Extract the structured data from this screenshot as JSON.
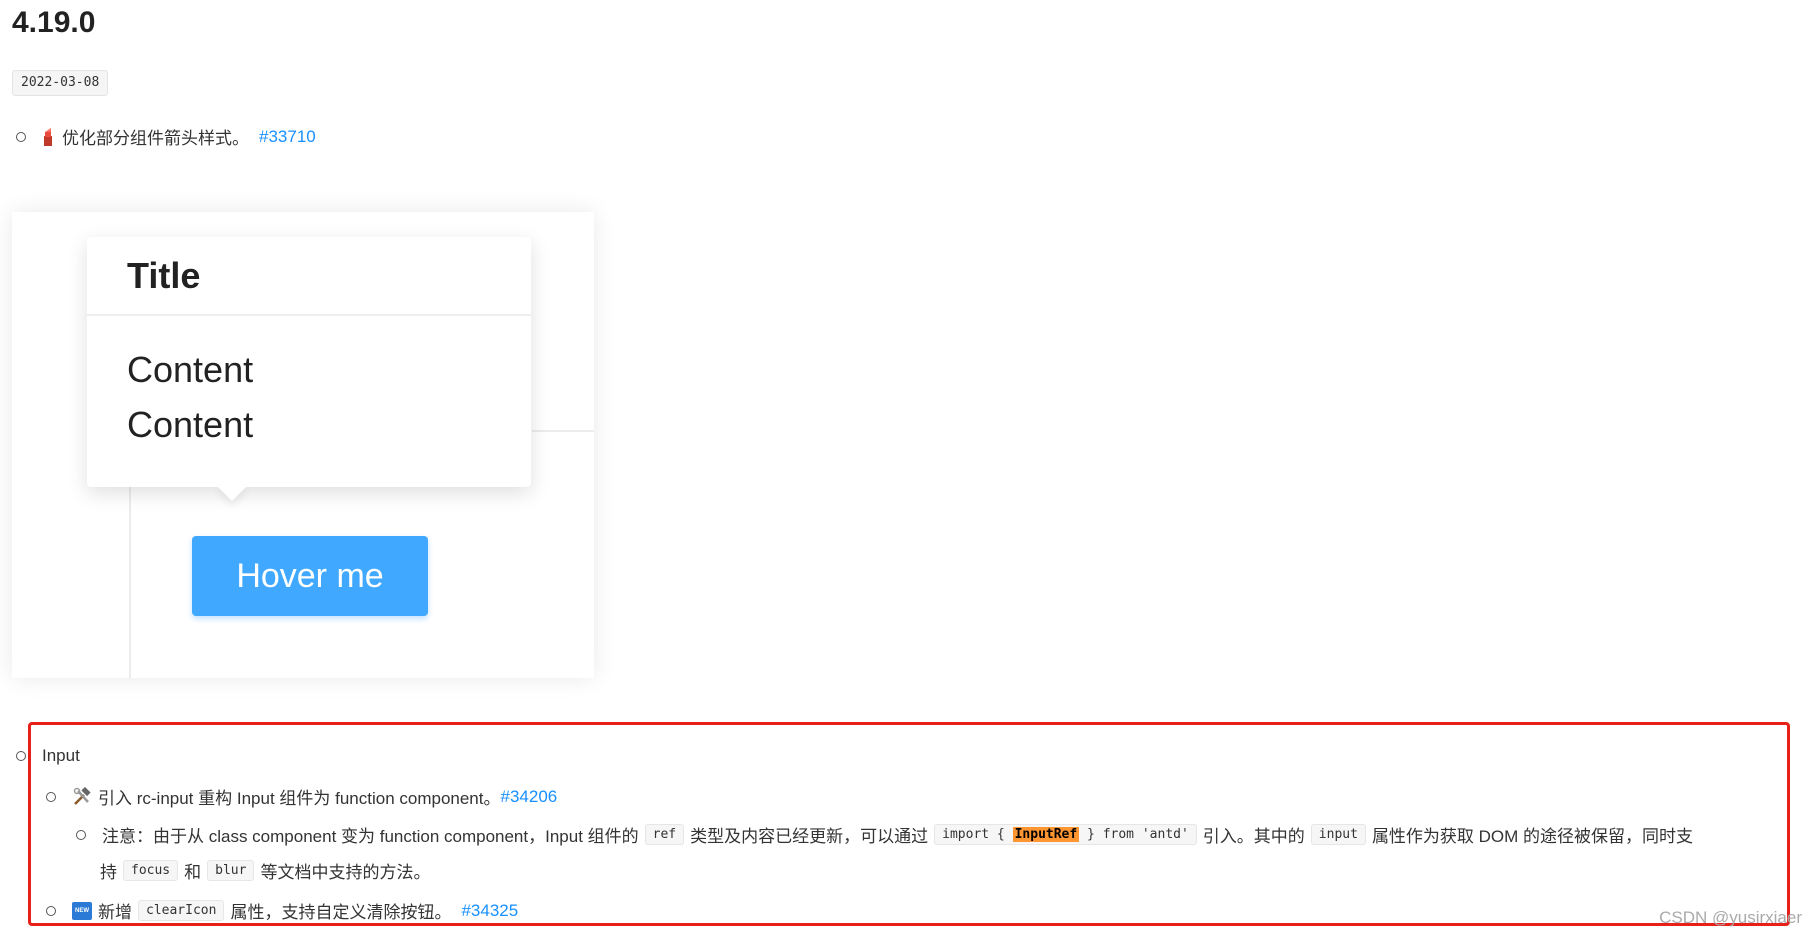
{
  "version": "4.19.0",
  "date": "2022-03-08",
  "changelog_items": [
    {
      "text": "优化部分组件箭头样式。",
      "link": "#33710",
      "icon": "lipstick-icon"
    }
  ],
  "demo": {
    "popover_title": "Title",
    "popover_content_1": "Content",
    "popover_content_2": "Content",
    "button_label": "Hover me"
  },
  "input_section": {
    "title": "Input",
    "item1": {
      "icon": "hammer-wrench-icon",
      "text": "引入 rc-input 重构 Input 组件为 function component。",
      "link": "#34206"
    },
    "note": {
      "part1": "注意：由于从 class component 变为 function component，Input 组件的",
      "code1": "ref",
      "part2": "类型及内容已经更新，可以通过",
      "code2_before": "import {",
      "code2_highlight": "InputRef",
      "code2_after": "} from 'antd'",
      "part3": "引入。其中的",
      "code3": "input",
      "part4": "属性作为获取 DOM 的途径被保留，同时支",
      "line2_part1": "持",
      "code4": "focus",
      "line2_part2": "和",
      "code5": "blur",
      "line2_part3": "等文档中支持的方法。"
    },
    "item2": {
      "icon": "new-icon",
      "icon_text": "NEW",
      "text_before": "新增",
      "code": "clearIcon",
      "text_after": "属性，支持自定义清除按钮。",
      "link": "#34325"
    }
  },
  "watermark": "CSDN @yusirxiaer",
  "colors": {
    "link": "#1890ff",
    "highlight_box": "#e8201a",
    "button": "#40a9ff",
    "code_highlight": "#ff9632"
  }
}
